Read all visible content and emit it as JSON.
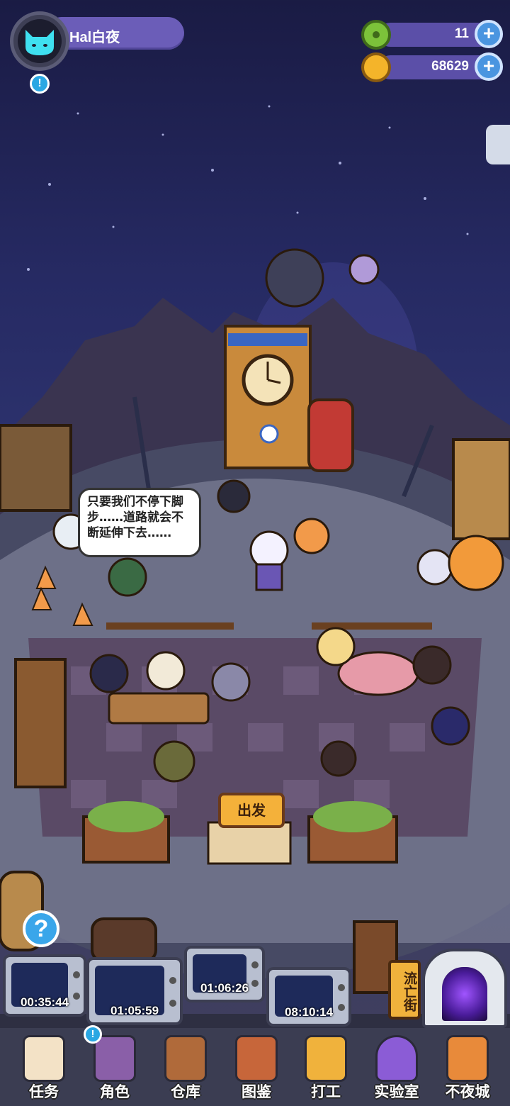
{
  "player": {
    "name": "Hal白夜",
    "alert": "!"
  },
  "currencies": [
    {
      "icon": "green-donut-icon",
      "value": "11",
      "color": "#7cc23a"
    },
    {
      "icon": "gold-planet-coin-icon",
      "value": "68629",
      "color": "#f4b42a"
    }
  ],
  "plus_symbol": "+",
  "scene": {
    "dialogue": "只要我们不停下脚步……道路就会不断延伸下去……",
    "depart_sign": "出发",
    "help_symbol": "?",
    "street_sign": "流亡街"
  },
  "timers": [
    "00:35:44",
    "01:05:59",
    "01:06:26",
    "08:10:14"
  ],
  "nav": [
    {
      "label": "任务",
      "icon": "task-scroll-icon",
      "color": "#f3e2c6"
    },
    {
      "label": "角色",
      "icon": "character-portrait-icon",
      "color": "#8a5fa8",
      "badge": "!"
    },
    {
      "label": "仓库",
      "icon": "storage-chest-icon",
      "color": "#b06a3a"
    },
    {
      "label": "图鉴",
      "icon": "encyclopedia-book-icon",
      "color": "#c7663a"
    },
    {
      "label": "打工",
      "icon": "work-monitor-icon",
      "color": "#f0b23c"
    },
    {
      "label": "实验室",
      "icon": "lab-flask-icon",
      "color": "#8b5cd6"
    },
    {
      "label": "不夜城",
      "icon": "cat-city-icon",
      "color": "#e88a3a"
    }
  ]
}
